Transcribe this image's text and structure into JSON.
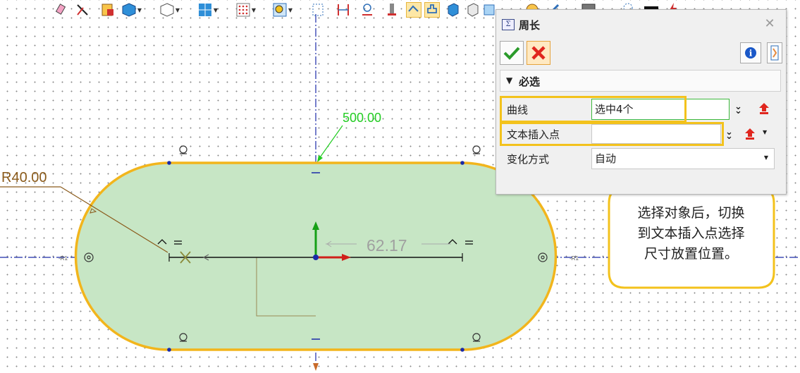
{
  "panel": {
    "title": "周长",
    "section_title": "必选",
    "rows": [
      {
        "label": "曲线",
        "value": "选中4个"
      },
      {
        "label": "文本插入点",
        "value": ""
      },
      {
        "label": "变化方式",
        "value": "自动"
      }
    ]
  },
  "canvas": {
    "dim_length": "500.00",
    "dim_radius": "R40.00",
    "dim_perimeter": "62.17"
  },
  "callout": {
    "lines": [
      "选择对象后，切换",
      "到文本插入点选择",
      "尺寸放置位置。"
    ]
  },
  "colors": {
    "shape_fill": "#c7e6c5",
    "shape_outline": "#f2b51c",
    "highlight": "#f3c21c",
    "centerline": "#1a2aa8",
    "dim_green": "#22cc22",
    "dim_brown": "#8a5a1a",
    "cancel_red": "#e0261e",
    "ok_green": "#2a9a2a"
  },
  "toolbar": {
    "icons": [
      "erase-icon",
      "trim-icon",
      "curve-list-icon",
      "solid-view-icon",
      "wireframe-view-icon",
      "view-layout-icon",
      "grid-icon",
      "zoom-icon",
      "dimension-frame-icon",
      "linear-dimension-icon",
      "radius-dimension-icon",
      "bar-icon",
      "constraint-icon",
      "perimeter-icon",
      "view-cube-icon",
      "box-view-icon",
      "isometric-icon",
      "sketch-icon",
      "pencil-icon",
      "display-icon",
      "color-box-icon",
      "lightning-icon"
    ]
  }
}
